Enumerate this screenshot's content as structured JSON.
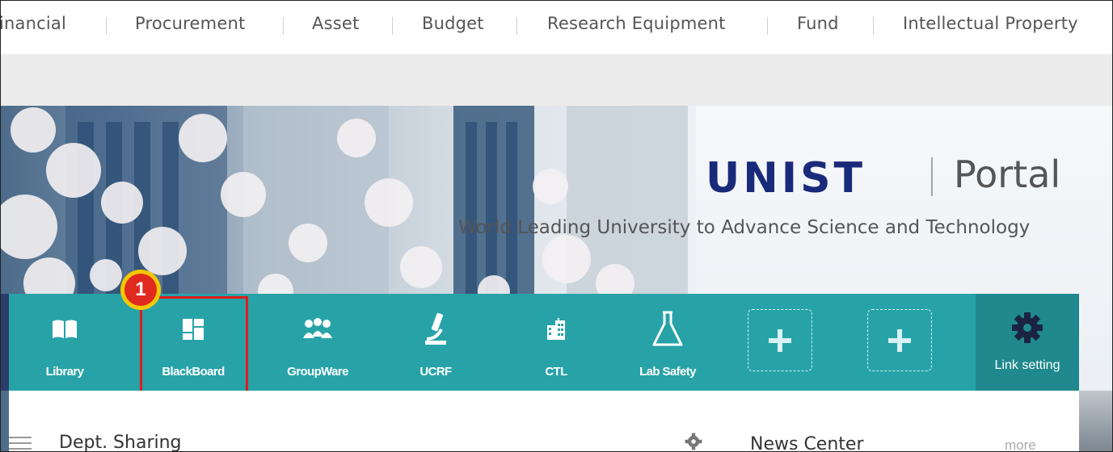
{
  "topnav": {
    "items": [
      "inancial",
      "Procurement",
      "Asset",
      "Budget",
      "Research Equipment",
      "Fund",
      "Intellectual Property"
    ]
  },
  "hero": {
    "brand": "UNIST",
    "portal": "Portal",
    "tagline": "World Leading University to Advance Science and Technology"
  },
  "links": {
    "library": "Library",
    "blackboard": "BlackBoard",
    "groupware": "GroupWare",
    "ucrf": "UCRF",
    "ctl": "CTL",
    "labsafety": "Lab Safety",
    "setting": "Link setting"
  },
  "annotation": {
    "step": "1"
  },
  "content": {
    "dept_sharing": "Dept. Sharing",
    "news_center": "News Center",
    "more": "more"
  },
  "colors": {
    "linkbar": "#27a3a8",
    "setting_bg": "#20898e",
    "highlight": "#e31b1b",
    "badge": "#f5c800"
  }
}
